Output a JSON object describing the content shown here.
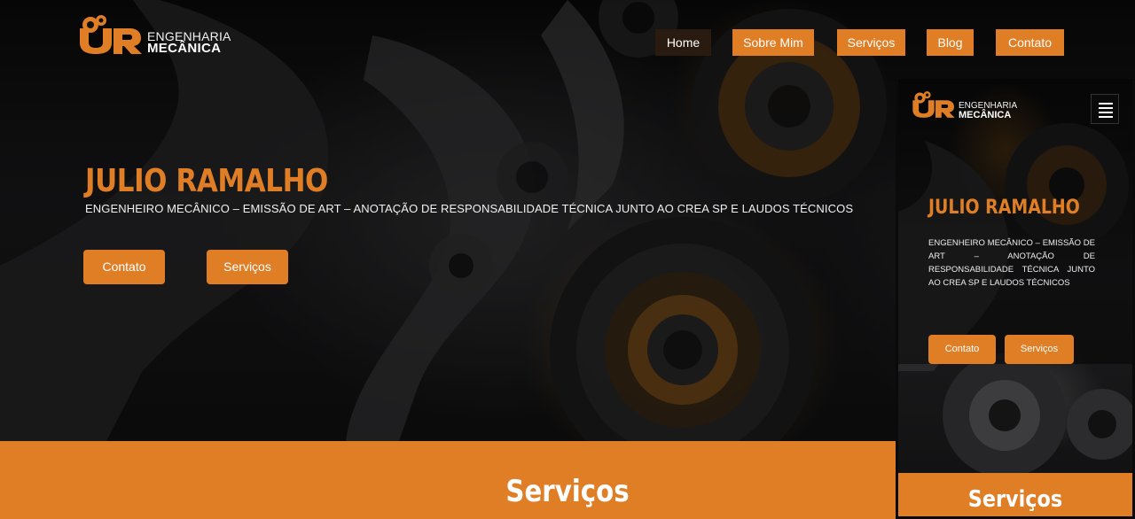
{
  "header": {
    "logo_line1": "ENGENHARIA",
    "logo_line2": "MECÂNICA"
  },
  "nav": {
    "items": [
      {
        "label": "Home",
        "active": true
      },
      {
        "label": "Sobre Mim",
        "active": false
      },
      {
        "label": "Serviços",
        "active": false
      },
      {
        "label": "Blog",
        "active": false
      },
      {
        "label": "Contato",
        "active": false
      }
    ]
  },
  "hero": {
    "title": "JULIO RAMALHO",
    "subtitle": "ENGENHEIRO MECÂNICO – EMISSÃO DE ART – ANOTAÇÃO DE RESPONSABILIDADE TÉCNICA JUNTO AO CREA SP E LAUDOS TÉCNICOS",
    "buttons": [
      {
        "label": "Contato"
      },
      {
        "label": "Serviços"
      }
    ]
  },
  "services": {
    "title": "Serviços"
  },
  "mobile": {
    "logo_line1": "ENGENHARIA",
    "logo_line2": "MECÂNICA",
    "title": "JULIO RAMALHO",
    "subtitle": "ENGENHEIRO MECÂNICO – EMISSÃO DE ART – ANOTAÇÃO DE RESPONSABILIDADE TÉCNICA JUNTO AO CREA SP E LAUDOS TÉCNICOS",
    "buttons": [
      {
        "label": "Contato"
      },
      {
        "label": "Serviços"
      }
    ],
    "services_title": "Serviços",
    "menu_icon": "hamburger-icon"
  },
  "colors": {
    "accent": "#e07e26",
    "nav_active": "#2a1b10",
    "dark": "#0e0e0f"
  }
}
